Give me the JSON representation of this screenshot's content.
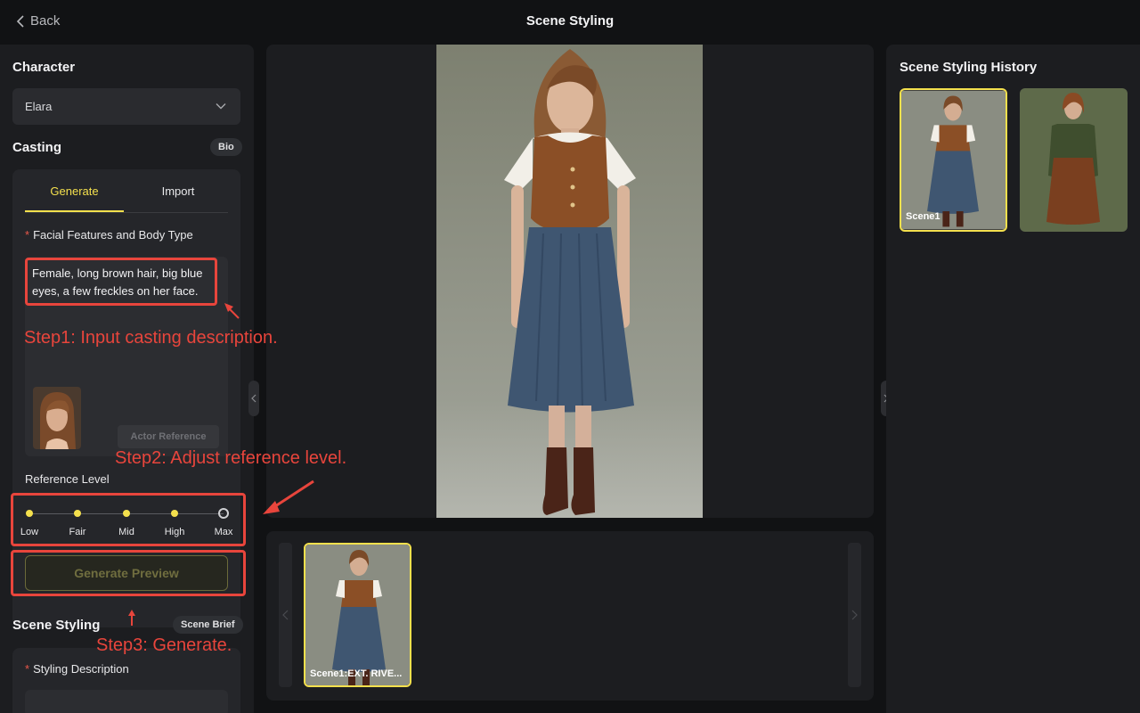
{
  "header": {
    "back_label": "Back",
    "title": "Scene Styling"
  },
  "character": {
    "title": "Character",
    "selected": "Elara"
  },
  "casting": {
    "title": "Casting",
    "bio_label": "Bio",
    "tabs": [
      {
        "label": "Generate",
        "active": true
      },
      {
        "label": "Import",
        "active": false
      }
    ],
    "field_label": "Facial Features and Body Type",
    "description": "Female, long brown hair, big blue eyes, a few freckles on her face.",
    "actor_reference_label": "Actor Reference",
    "reference_level_label": "Reference Level",
    "levels": [
      "Low",
      "Fair",
      "Mid",
      "High",
      "Max"
    ],
    "generate_preview_label": "Generate Preview"
  },
  "scene_styling": {
    "title": "Scene Styling",
    "brief_label": "Scene Brief",
    "styling_description_label": "Styling Description"
  },
  "strip": {
    "thumb_caption": "Scene1:EXT. RIVE..."
  },
  "history": {
    "title": "Scene Styling History",
    "items": [
      {
        "caption": "Scene1"
      },
      {
        "caption": ""
      }
    ]
  },
  "annotations": {
    "step1": "Step1: Input casting description.",
    "step2": "Step2: Adjust reference level.",
    "step3": "Step3: Generate."
  },
  "colors": {
    "accent": "#f4e04d",
    "annotation": "#e8453c",
    "background": "#111214",
    "panel": "#1c1d20"
  }
}
